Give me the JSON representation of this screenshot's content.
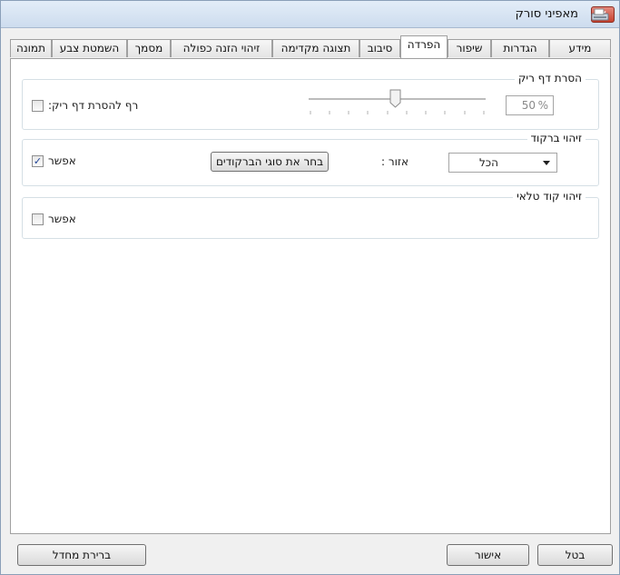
{
  "window": {
    "title": "מאפיני סורק",
    "close_glyph": "✕"
  },
  "tabs": [
    {
      "label": "מידע",
      "active": false
    },
    {
      "label": "הגדרות",
      "active": false
    },
    {
      "label": "שיפור",
      "active": false
    },
    {
      "label": "הפרדה",
      "active": true
    },
    {
      "label": "סיבוב",
      "active": false
    },
    {
      "label": "תצוגה מקדימה",
      "active": false
    },
    {
      "label": "זיהוי הזנה כפולה",
      "active": false
    },
    {
      "label": "מסמך",
      "active": false
    },
    {
      "label": "השמטת צבע",
      "active": false
    },
    {
      "label": "תמונה",
      "active": false
    }
  ],
  "blank_page": {
    "legend": "הסרת דף ריק",
    "checkbox_label": ":רף להסרת דף ריק",
    "checked": false,
    "slider_value_percent": 50,
    "value_text": "50",
    "unit": "%"
  },
  "barcode": {
    "legend": "זיהוי ברקוד",
    "enable_label": "אפשר",
    "checked": true,
    "select_types_button": "בחר את סוגי הברקודים",
    "area_label": ": אזור",
    "area_value": "הכל"
  },
  "patch_code": {
    "legend": "זיהוי קוד טלאי",
    "enable_label": "אפשר",
    "checked": false
  },
  "footer": {
    "default_button": "ברירת מחדל",
    "ok_button": "אישור",
    "cancel_button": "בטל"
  },
  "icons": {
    "close": "close-icon",
    "app": "scanner-icon",
    "dropdown": "chevron-down-icon",
    "checkmark": "checkmark-icon"
  }
}
